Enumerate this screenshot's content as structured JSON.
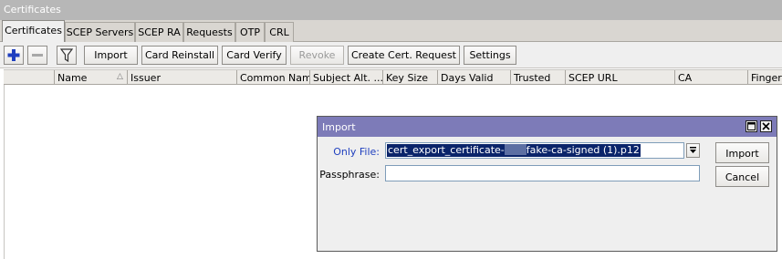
{
  "window": {
    "title": "Certificates"
  },
  "tabs": [
    {
      "label": "Certificates",
      "active": true
    },
    {
      "label": "SCEP Servers"
    },
    {
      "label": "SCEP RA"
    },
    {
      "label": "Requests"
    },
    {
      "label": "OTP"
    },
    {
      "label": "CRL"
    }
  ],
  "toolbar": {
    "add_icon": "plus-icon",
    "remove_icon": "minus-icon",
    "filter_icon": "filter-icon",
    "import_label": "Import",
    "card_reinstall_label": "Card Reinstall",
    "card_verify_label": "Card Verify",
    "revoke_label": "Revoke",
    "create_request_label": "Create Cert. Request",
    "settings_label": "Settings"
  },
  "columns": [
    "Name",
    "Issuer",
    "Common Name",
    "Subject Alt. ...",
    "Key Size",
    "Days Valid",
    "Trusted",
    "SCEP URL",
    "CA",
    "Fingerpr"
  ],
  "sort_column": "Name",
  "dialog": {
    "title": "Import",
    "only_file_label": "Only File:",
    "only_file_value": "cert_export_certificate-",
    "only_file_value_suffix": "fake-ca-signed (1).p12",
    "passphrase_label": "Passphrase:",
    "passphrase_value": "",
    "import_button": "Import",
    "cancel_button": "Cancel"
  },
  "colors": {
    "dialog_title": "#7d7bb8",
    "selection": "#0a246a",
    "add_blue": "#1f3fbf"
  }
}
